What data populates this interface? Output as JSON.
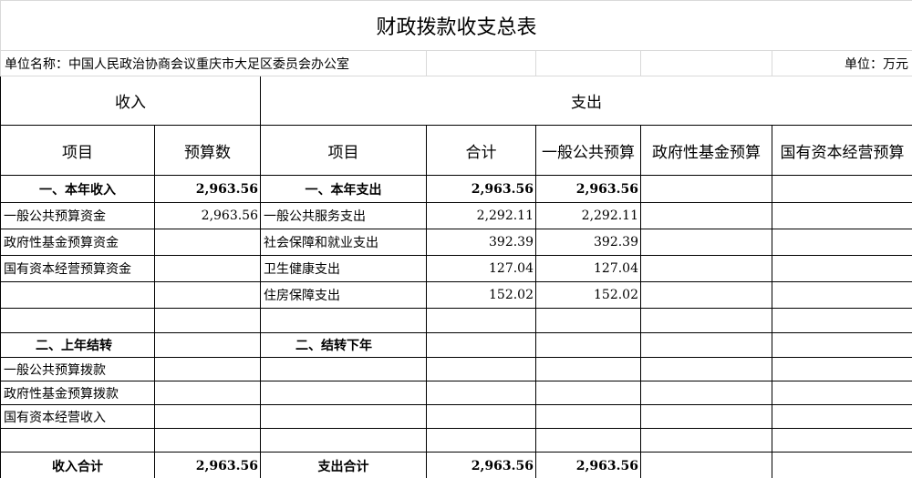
{
  "title": "财政拨款收支总表",
  "unit_name": "单位名称：中国人民政治协商会议重庆市大足区委员会办公室",
  "unit_measure": "单位：万元",
  "headers": {
    "income_group": "收入",
    "expense_group": "支出",
    "income_item": "项目",
    "income_budget": "预算数",
    "expense_item": "项目",
    "total": "合计",
    "general_budget": "一般公共预算",
    "gov_fund_budget": "政府性基金预算",
    "state_capital_budget": "国有资本经营预算"
  },
  "rows": [
    {
      "income_label": "一、本年收入",
      "income_value": "2,963.56",
      "expense_label": "一、本年支出",
      "total": "2,963.56",
      "general": "2,963.56",
      "gov_fund": "",
      "state_capital": "",
      "bold": true
    },
    {
      "income_label": "一般公共预算资金",
      "income_value": "2,963.56",
      "expense_label": "一般公共服务支出",
      "total": "2,292.11",
      "general": "2,292.11",
      "gov_fund": "",
      "state_capital": "",
      "bold": false
    },
    {
      "income_label": "政府性基金预算资金",
      "income_value": "",
      "expense_label": "社会保障和就业支出",
      "total": "392.39",
      "general": "392.39",
      "gov_fund": "",
      "state_capital": "",
      "bold": false
    },
    {
      "income_label": "国有资本经营预算资金",
      "income_value": "",
      "expense_label": "卫生健康支出",
      "total": "127.04",
      "general": "127.04",
      "gov_fund": "",
      "state_capital": "",
      "bold": false
    },
    {
      "income_label": "",
      "income_value": "",
      "expense_label": "住房保障支出",
      "total": "152.02",
      "general": "152.02",
      "gov_fund": "",
      "state_capital": "",
      "bold": false
    },
    {
      "income_label": "",
      "income_value": "",
      "expense_label": "",
      "total": "",
      "general": "",
      "gov_fund": "",
      "state_capital": "",
      "bold": false
    },
    {
      "income_label": "二、上年结转",
      "income_value": "",
      "expense_label": "二、结转下年",
      "total": "",
      "general": "",
      "gov_fund": "",
      "state_capital": "",
      "bold": true
    },
    {
      "income_label": "一般公共预算拨款",
      "income_value": "",
      "expense_label": "",
      "total": "",
      "general": "",
      "gov_fund": "",
      "state_capital": "",
      "bold": false
    },
    {
      "income_label": "政府性基金预算拨款",
      "income_value": "",
      "expense_label": "",
      "total": "",
      "general": "",
      "gov_fund": "",
      "state_capital": "",
      "bold": false
    },
    {
      "income_label": "国有资本经营收入",
      "income_value": "",
      "expense_label": "",
      "total": "",
      "general": "",
      "gov_fund": "",
      "state_capital": "",
      "bold": false
    },
    {
      "income_label": "",
      "income_value": "",
      "expense_label": "",
      "total": "",
      "general": "",
      "gov_fund": "",
      "state_capital": "",
      "bold": false
    }
  ],
  "totals": {
    "income_label": "收入合计",
    "income_value": "2,963.56",
    "expense_label": "支出合计",
    "total": "2,963.56",
    "general": "2,963.56",
    "gov_fund": "",
    "state_capital": ""
  }
}
